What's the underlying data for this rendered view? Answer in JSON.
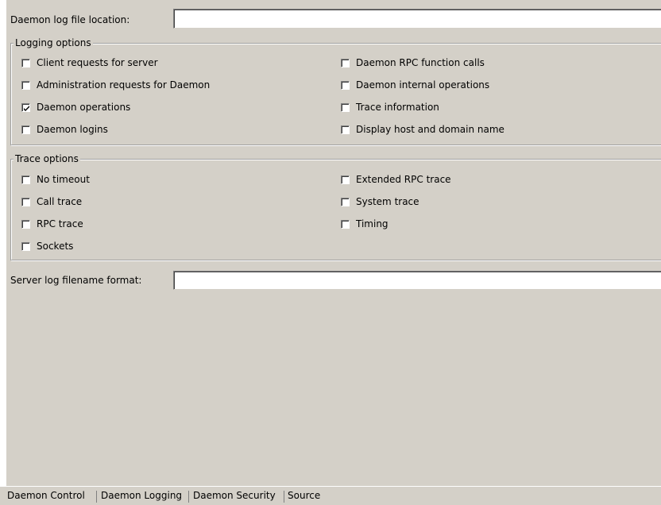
{
  "daemon_log": {
    "label": "Daemon log file location:",
    "value": ""
  },
  "logging_options": {
    "title": "Logging options",
    "items": [
      {
        "label": "Client requests for server",
        "checked": false
      },
      {
        "label": "Administration requests for Daemon",
        "checked": false
      },
      {
        "label": "Daemon operations",
        "checked": true
      },
      {
        "label": "Daemon logins",
        "checked": false
      },
      {
        "label": "Daemon RPC function calls",
        "checked": false
      },
      {
        "label": "Daemon internal operations",
        "checked": false
      },
      {
        "label": "Trace information",
        "checked": false
      },
      {
        "label": "Display host and domain name",
        "checked": false
      }
    ]
  },
  "trace_options": {
    "title": "Trace options",
    "items": [
      {
        "label": "No timeout",
        "checked": false
      },
      {
        "label": "Call trace",
        "checked": false
      },
      {
        "label": "RPC trace",
        "checked": false
      },
      {
        "label": "Sockets",
        "checked": false
      },
      {
        "label": "Extended RPC trace",
        "checked": false
      },
      {
        "label": "System trace",
        "checked": false
      },
      {
        "label": "Timing",
        "checked": false
      }
    ]
  },
  "server_log": {
    "label": "Server log filename format:",
    "value": ""
  },
  "tabs": [
    {
      "label": "Daemon Control",
      "active": false
    },
    {
      "label": "Daemon Logging",
      "active": true
    },
    {
      "label": "Daemon Security",
      "active": false
    },
    {
      "label": "Source",
      "active": false
    }
  ]
}
